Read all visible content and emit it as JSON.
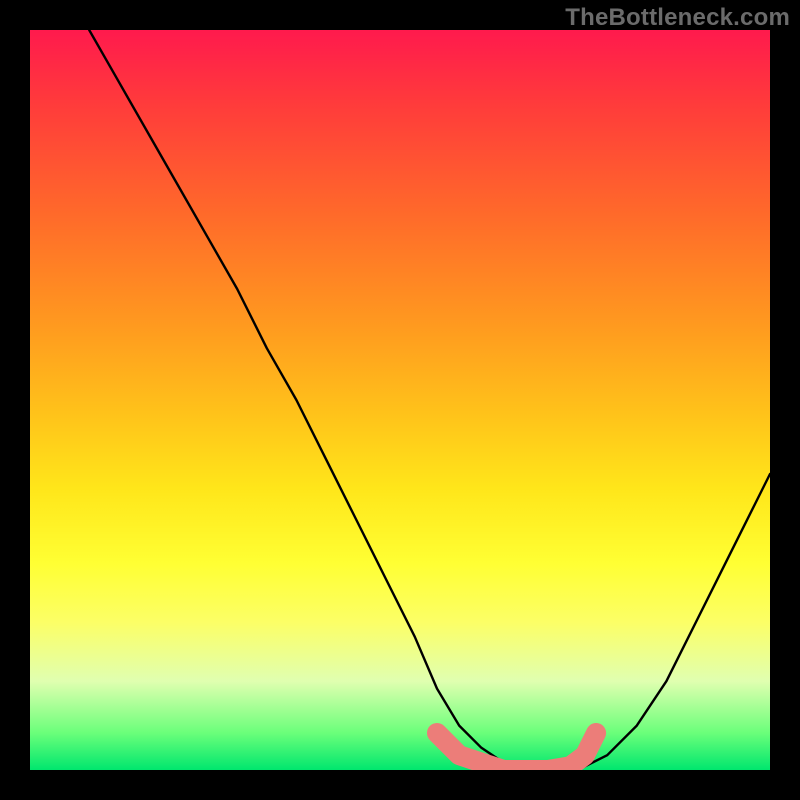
{
  "watermark": "TheBottleneck.com",
  "chart_data": {
    "type": "line",
    "title": "",
    "xlabel": "",
    "ylabel": "",
    "xlim": [
      0,
      100
    ],
    "ylim": [
      0,
      100
    ],
    "series": [
      {
        "name": "bottleneck-curve",
        "x": [
          8,
          12,
          16,
          20,
          24,
          28,
          32,
          36,
          40,
          44,
          48,
          52,
          55,
          58,
          61,
          64,
          67,
          70,
          74,
          78,
          82,
          86,
          90,
          94,
          98,
          100
        ],
        "y": [
          100,
          93,
          86,
          79,
          72,
          65,
          57,
          50,
          42,
          34,
          26,
          18,
          11,
          6,
          3,
          1,
          0,
          0,
          0,
          2,
          6,
          12,
          20,
          28,
          36,
          40
        ]
      }
    ],
    "highlight_band": {
      "name": "optimal-range",
      "color": "#ec7d79",
      "x": [
        55,
        58,
        61,
        64,
        67,
        70,
        73,
        75,
        76.5
      ],
      "y": [
        5,
        2,
        1,
        0,
        0,
        0,
        0.5,
        2,
        5
      ]
    },
    "gradient_stops": [
      {
        "pos": 0.0,
        "color": "#ff1a4d"
      },
      {
        "pos": 0.1,
        "color": "#ff3b3b"
      },
      {
        "pos": 0.25,
        "color": "#ff6a2a"
      },
      {
        "pos": 0.4,
        "color": "#ff9a1f"
      },
      {
        "pos": 0.52,
        "color": "#ffc31a"
      },
      {
        "pos": 0.62,
        "color": "#ffe61a"
      },
      {
        "pos": 0.72,
        "color": "#ffff33"
      },
      {
        "pos": 0.8,
        "color": "#fcff66"
      },
      {
        "pos": 0.88,
        "color": "#e0ffb0"
      },
      {
        "pos": 0.95,
        "color": "#6aff7a"
      },
      {
        "pos": 1.0,
        "color": "#00e66e"
      }
    ]
  }
}
